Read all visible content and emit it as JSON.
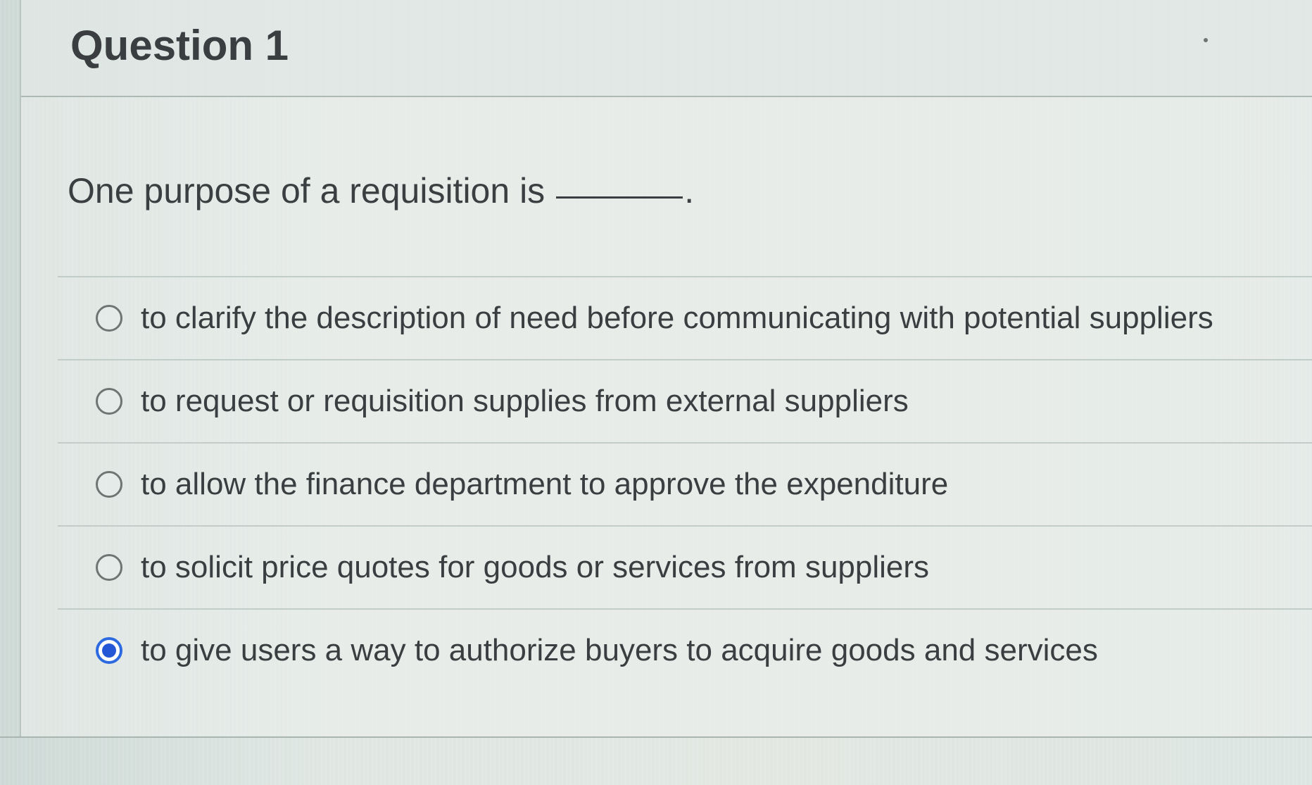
{
  "question": {
    "title": "Question 1",
    "prompt": "One purpose of a requisition is",
    "blank_suffix": "."
  },
  "answers": [
    {
      "label": "to clarify the description of need before communicating with potential suppliers",
      "selected": false
    },
    {
      "label": "to request or requisition supplies from external suppliers",
      "selected": false
    },
    {
      "label": "to allow the finance department to approve the expenditure",
      "selected": false
    },
    {
      "label": "to solicit price quotes for goods or services from suppliers",
      "selected": false
    },
    {
      "label": "to give users a way to authorize buyers to acquire goods and services",
      "selected": true
    }
  ],
  "colors": {
    "selected_radio": "#2457d6",
    "text": "#3b3e41",
    "background": "#dfe7e3"
  }
}
